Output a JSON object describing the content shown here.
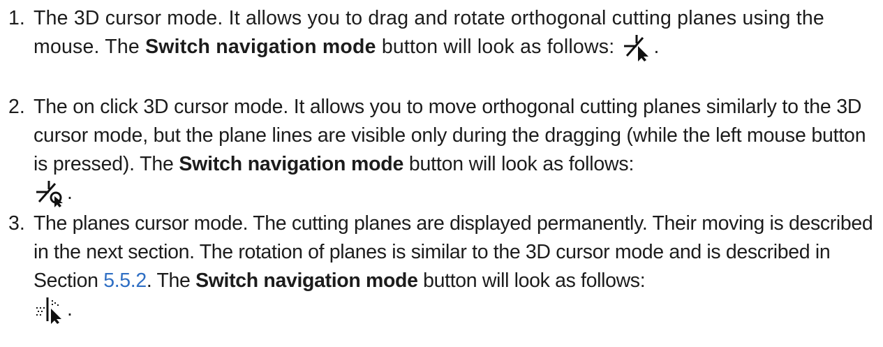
{
  "items": [
    {
      "number": "1.",
      "part1": "The 3D cursor mode. It allows you to drag and rotate orthogonal cutting planes using the mouse. The ",
      "bold": "Switch navigation mode",
      "part2": " button will look as follows: ",
      "end": ".",
      "icon": "3d-cursor-mode-icon"
    },
    {
      "number": "2.",
      "part1": "The on click 3D cursor mode. It allows you to move orthogonal cutting planes similarly to the 3D cursor mode, but the plane lines are visible only during the dragging (while the left mouse button is pressed). The ",
      "bold": "Switch navigation mode",
      "part2": " button will look as follows:",
      "end": ".",
      "icon": "on-click-3d-cursor-mode-icon"
    },
    {
      "number": "3.",
      "part1": "The planes cursor mode. The cutting planes are displayed permanently. Their moving is described in the next section. The rotation of planes is similar to the 3D cursor mode and is described in Section ",
      "link": "5.5.2",
      "part1b": ". The ",
      "bold": "Switch navigation mode",
      "part2": " button will look as follows:",
      "end": ".",
      "icon": "planes-cursor-mode-icon"
    }
  ]
}
